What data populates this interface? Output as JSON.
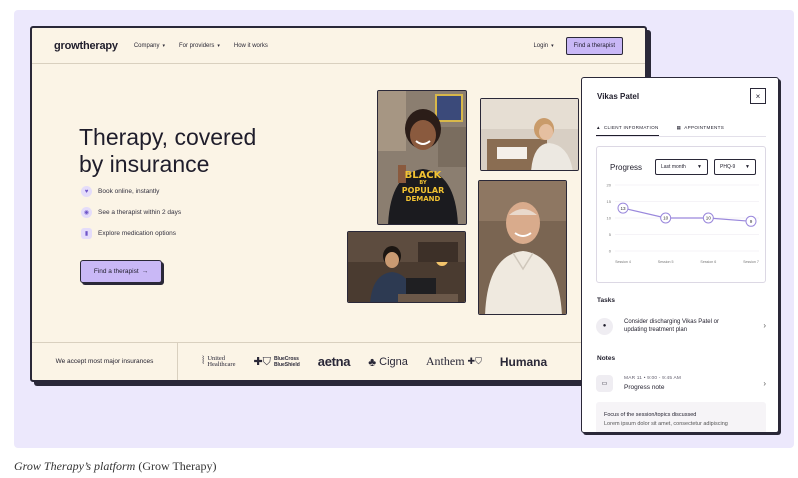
{
  "nav": {
    "logo": "growtherapy",
    "links": [
      "Company",
      "For providers",
      "How it works"
    ],
    "login": "Login",
    "cta": "Find a therapist"
  },
  "hero": {
    "title_line1": "Therapy, covered",
    "title_line2": "by insurance",
    "features": [
      {
        "icon": "heart-icon",
        "text": "Book online, instantly"
      },
      {
        "icon": "eye-icon",
        "text": "See a therapist within 2 days"
      },
      {
        "icon": "pill-icon",
        "text": "Explore medication options"
      }
    ],
    "cta": "Find a therapist",
    "cta_arrow": "→"
  },
  "photo_tshirt": {
    "line1": "BLACK",
    "line2": "BY",
    "line3": "POPULAR",
    "line4": "DEMAND"
  },
  "insurance": {
    "label": "We accept most major insurances",
    "brands": [
      {
        "name_line1": "United",
        "name_line2": "Healthcare",
        "icon": "united-healthcare-logo-icon"
      },
      {
        "name_line1": "BlueCross",
        "name_line2": "BlueShield",
        "icon": "bluecross-blueshield-logo-icon"
      },
      {
        "name_line1": "aetna",
        "icon": "aetna-logo"
      },
      {
        "name_line1": "Cigna",
        "icon": "cigna-tree-icon"
      },
      {
        "name_line1": "Anthem",
        "icon": "anthem-logo-icon"
      },
      {
        "name_line1": "Humana",
        "icon": "humana-logo"
      }
    ]
  },
  "panel": {
    "client_name": "Vikas Patel",
    "close": "×",
    "tabs": [
      {
        "label": "CLIENT INFORMATION",
        "icon": "person-icon",
        "active": true
      },
      {
        "label": "APPOINTMENTS",
        "icon": "calendar-icon",
        "active": false
      }
    ],
    "progress_title": "Progress",
    "range_select": "Last month",
    "measure_select": "PHQ-9",
    "tasks_heading": "Tasks",
    "task_text_line1": "Consider discharging Vikas Patel or",
    "task_text_line2": "updating treatment plan",
    "notes_heading": "Notes",
    "note_meta": "MAR 11 • 9:00 - 9:45 AM",
    "note_title": "Progress note",
    "note_body_line1": "Focus of the session/topics discussed",
    "note_body_line2": "Lorem ipsum dolor sit amet, consectetur adipiscing"
  },
  "chart_data": {
    "type": "line",
    "title": "Progress",
    "categories": [
      "Session 4",
      "Session 5",
      "Session 6",
      "Session 7"
    ],
    "series": [
      {
        "values": [
          13,
          10,
          10,
          9
        ]
      }
    ],
    "y_ticks": [
      0,
      5,
      10,
      15,
      20
    ],
    "ylim": [
      0,
      20
    ],
    "grid": true,
    "line_color": "#9a88dc"
  },
  "caption": {
    "italic": "Grow Therapy’s platform",
    "rest": " (Grow Therapy)"
  }
}
